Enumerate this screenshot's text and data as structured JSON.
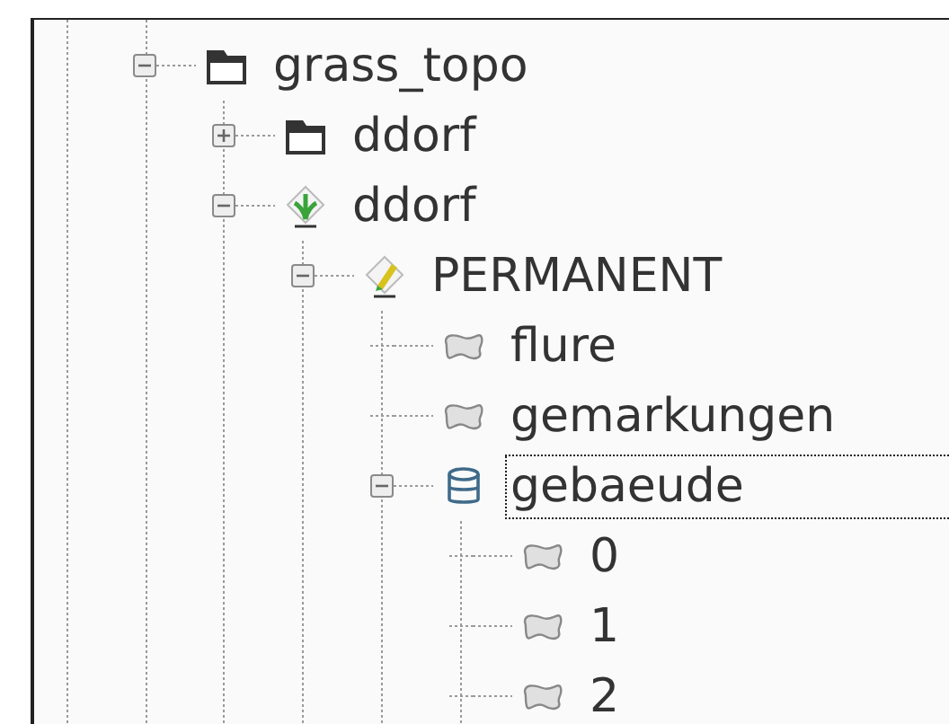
{
  "tree": [
    {
      "label": "grass_topo",
      "kind": "folder",
      "expanded": true,
      "selected": false,
      "children": [
        {
          "label": "ddorf",
          "kind": "folder",
          "expanded": false,
          "selected": false
        },
        {
          "label": "ddorf",
          "kind": "location",
          "expanded": true,
          "selected": false,
          "children": [
            {
              "label": "PERMANENT",
              "kind": "mapset",
              "expanded": true,
              "selected": false,
              "children": [
                {
                  "label": "flure",
                  "kind": "vector",
                  "selected": false
                },
                {
                  "label": "gemarkungen",
                  "kind": "vector",
                  "selected": false
                },
                {
                  "label": "gebaeude",
                  "kind": "database",
                  "expanded": true,
                  "selected": true,
                  "children": [
                    {
                      "label": "0",
                      "kind": "vector",
                      "selected": false
                    },
                    {
                      "label": "1",
                      "kind": "vector",
                      "selected": false
                    },
                    {
                      "label": "2",
                      "kind": "vector",
                      "selected": false
                    }
                  ]
                }
              ]
            }
          ]
        }
      ]
    }
  ]
}
